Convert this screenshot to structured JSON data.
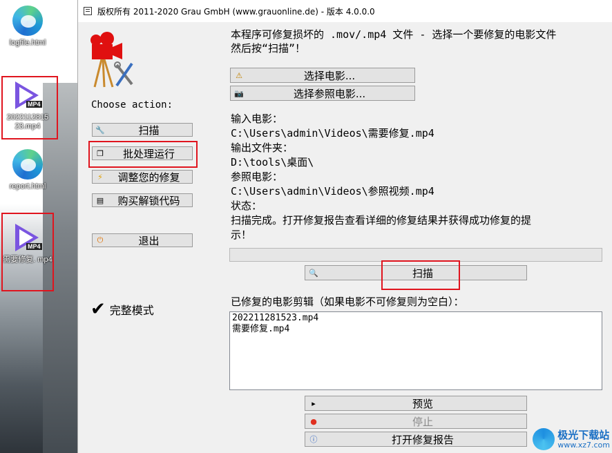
{
  "desktop": {
    "icons": [
      {
        "label": "logfile.html",
        "type": "edge-icon"
      },
      {
        "label": "2022112815 23.mp4",
        "type": "mp4-icon"
      },
      {
        "label": "report.html",
        "type": "edge-icon"
      },
      {
        "label": "需要修复. mp4",
        "type": "mp4-icon"
      }
    ],
    "mp4_tag": "MP4"
  },
  "window": {
    "title": "版权所有 2011-2020 Grau GmbH (www.grauonline.de) - 版本 4.0.0.0"
  },
  "left": {
    "choose_action": "Choose action:",
    "buttons": {
      "scan": "扫描",
      "batch": "批处理运行",
      "adjust": "调整您的修复",
      "buy": "购买解锁代码",
      "exit": "退出"
    },
    "full_mode": "完整模式"
  },
  "main": {
    "intro_line1": "本程序可修复损坏的 .mov/.mp4 文件 - 选择一个要修复的电影文件",
    "intro_line2": "然后按“扫描”！",
    "select_movie": "选择电影...",
    "select_ref": "选择参照电影...",
    "input_label": "输入电影：",
    "input_value": "C:\\Users\\admin\\Videos\\需要修复.mp4",
    "output_label": "输出文件夹：",
    "output_value": "D:\\tools\\桌面\\",
    "ref_label": "参照电影：",
    "ref_value": "C:\\Users\\admin\\Videos\\参照视频.mp4",
    "status_label": "状态：",
    "status_line1": "扫描完成。打开修复报告查看详细的修复结果并获得成功修复的提",
    "status_line2": "示！",
    "scan_button": "扫描",
    "repaired_label": "已修复的电影剪辑（如果电影不可修复则为空白）：",
    "repaired_files": [
      "202211281523.mp4",
      "需要修复.mp4"
    ],
    "preview": "预览",
    "stop": "停止",
    "open_report": "打开修复报告"
  },
  "watermark": {
    "text1": "极光下载站",
    "text2": "www.xz7.com"
  },
  "colors": {
    "highlight_box": "#e0141e",
    "button_bg": "#e3e3e3",
    "window_bg": "#f0f0f0"
  }
}
